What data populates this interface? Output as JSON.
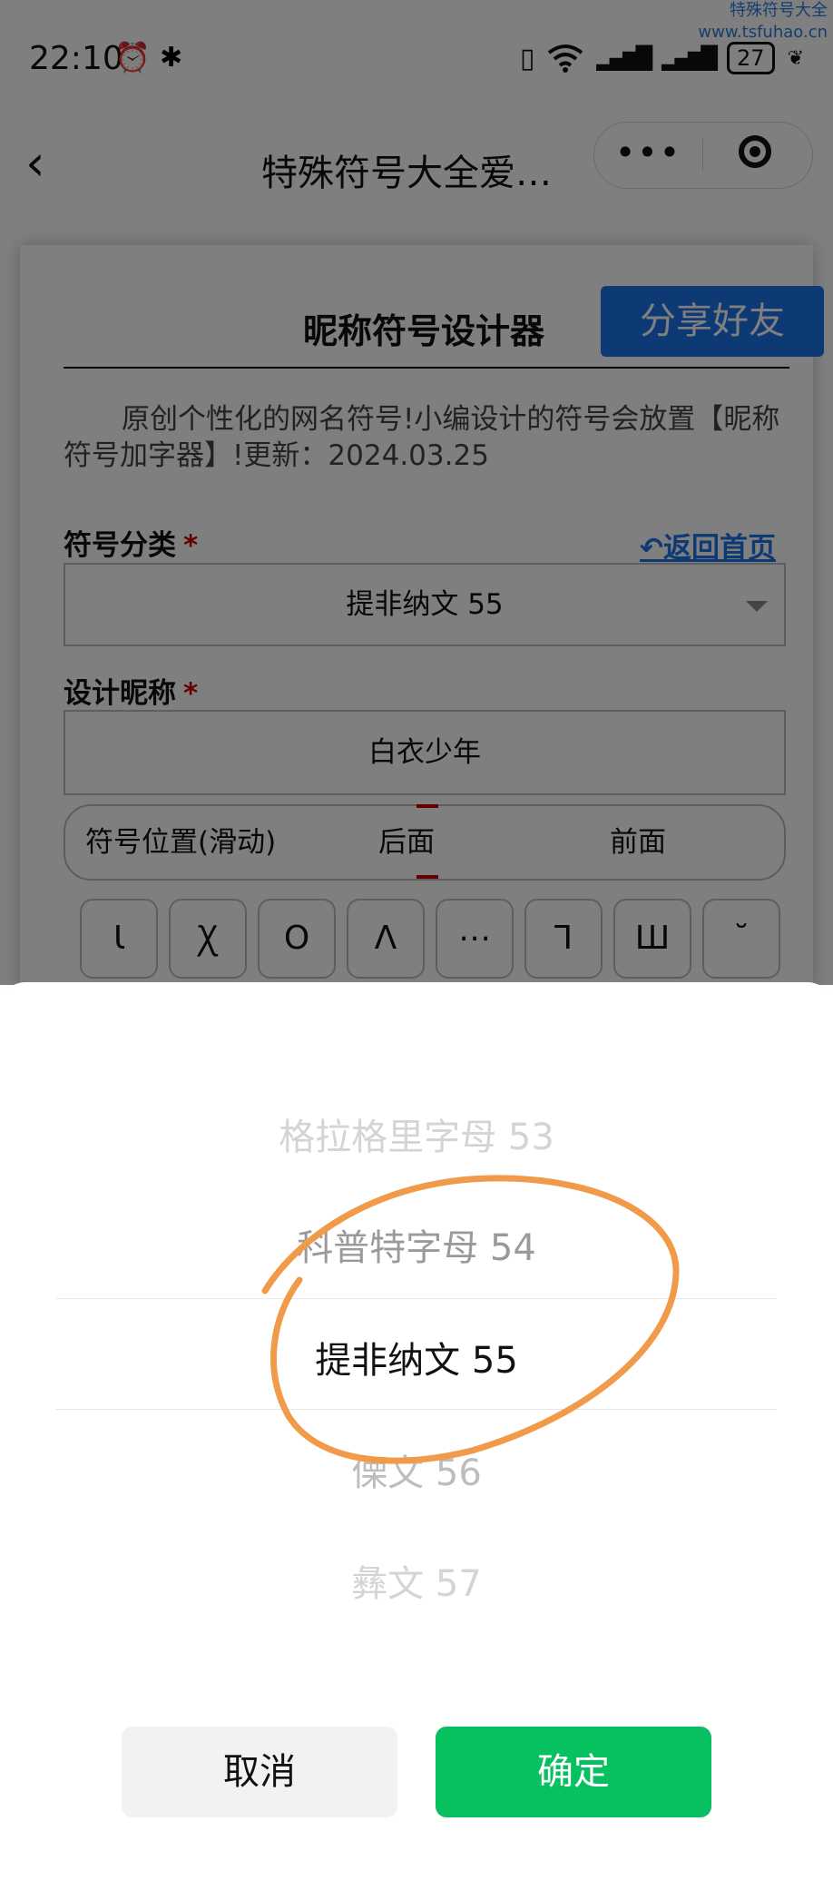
{
  "status_bar": {
    "time": "22:10",
    "alarm_icon": "⏰",
    "bluetooth_icon": "✱",
    "vibrate_icon": "▯",
    "wifi_icon": "wifi-icon",
    "signal1": "▂▄▆█",
    "signal2": "▂▄▆█",
    "battery": "27",
    "leaf": "❦"
  },
  "watermark": {
    "line1": "特殊符号大全",
    "line2": "www.tsfuhao.cn"
  },
  "navbar": {
    "back": "‹",
    "title": "特殊符号大全爱…",
    "more": "•••"
  },
  "card": {
    "title": "昵称符号设计器",
    "share_button": "分享好友",
    "description": "原创个性化的网名符号!小编设计的符号会放置【昵称符号加字器】!更新：2024.03.25",
    "category_label": "符号分类",
    "required_mark": "*",
    "home_link": "↶返回首页",
    "category_value": "提非纳文 55",
    "nickname_label": "设计昵称",
    "nickname_value": "白衣少年",
    "position_label": "符号位置(滑动)",
    "position_after": "后面",
    "position_before": "前面",
    "symbols": [
      "Ꙇ",
      "Ꭓ",
      "Ο",
      "Ʌ",
      "⋯",
      "Ꞁ",
      "Ш",
      "˘"
    ]
  },
  "picker": {
    "items": [
      "格拉格里字母 53",
      "科普特字母 54",
      "提非纳文 55",
      "傈文 56",
      "彝文 57"
    ],
    "selected_index": 2,
    "cancel": "取消",
    "confirm": "确定"
  },
  "colors": {
    "share": "#1a73e8",
    "confirm": "#07c160",
    "required": "#cc0000",
    "annotation": "#f09a4a"
  }
}
